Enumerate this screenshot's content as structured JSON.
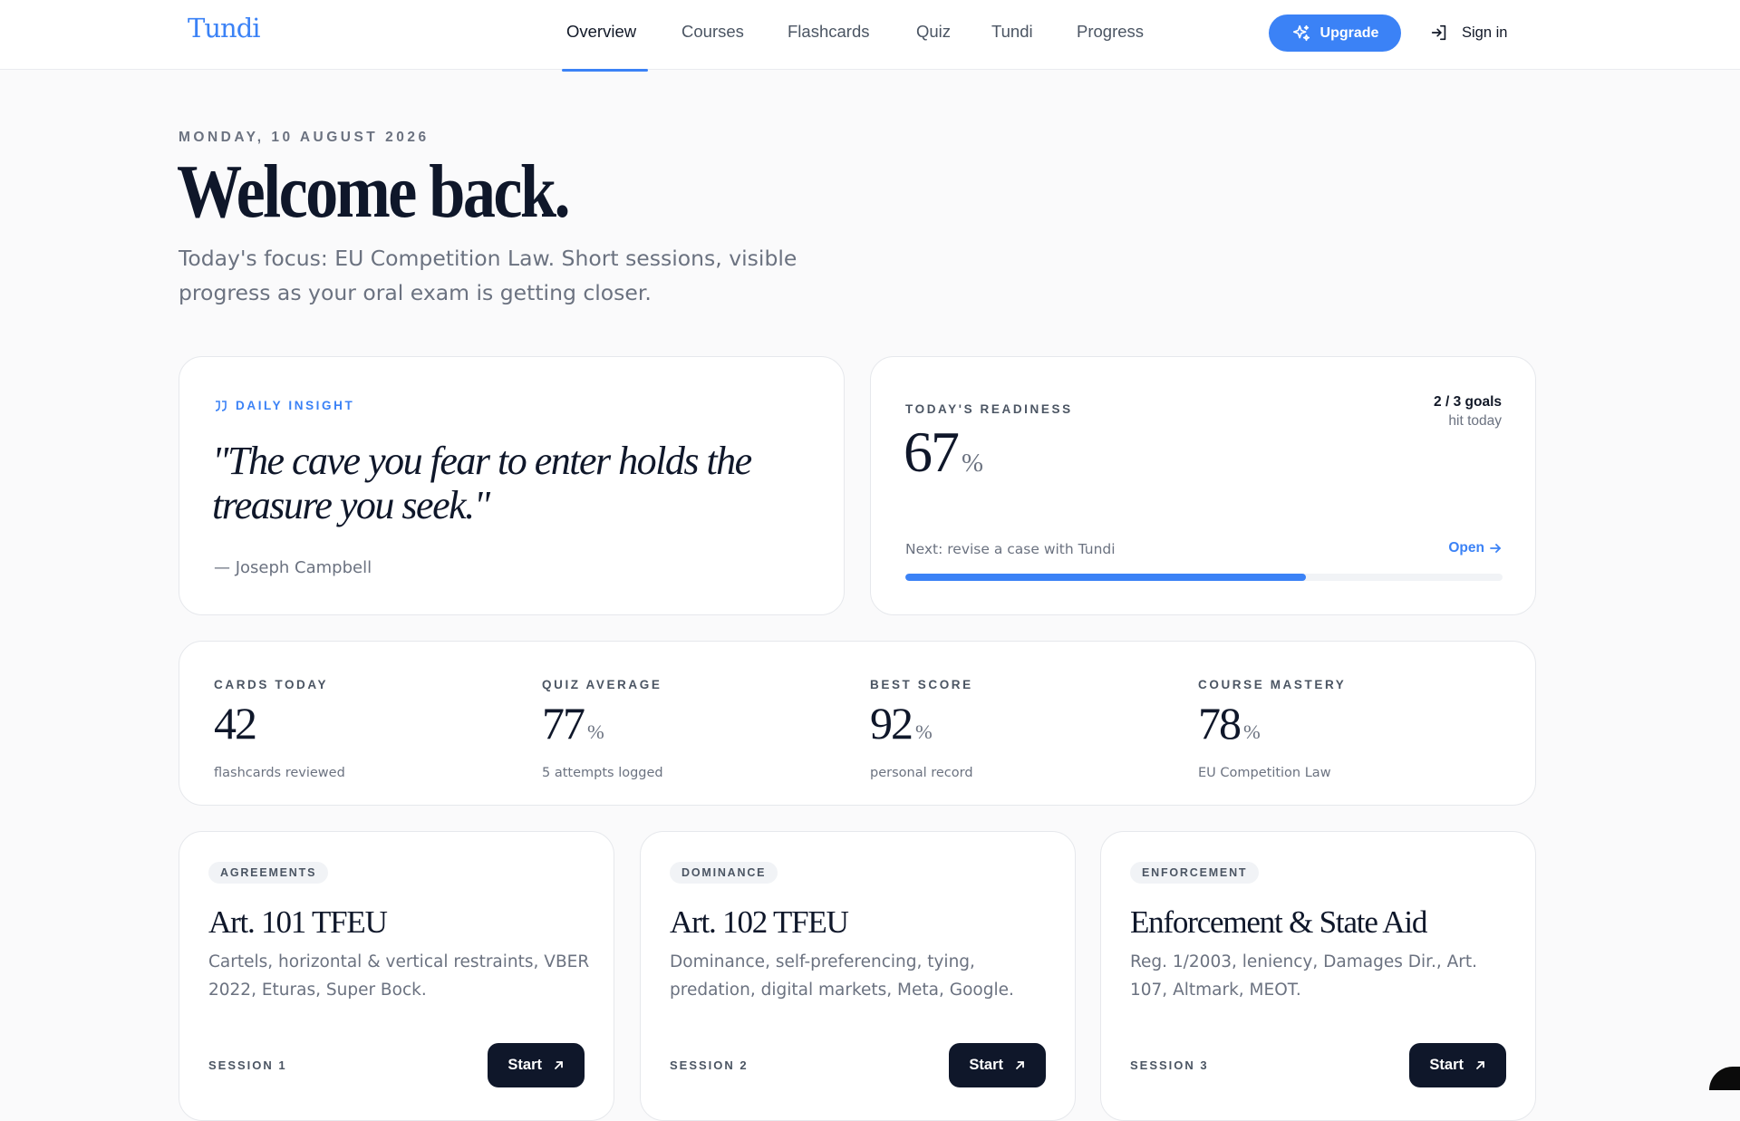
{
  "brand": {
    "logo": "Tundi",
    "accent": "#3b82f6",
    "dark": "#0f172a"
  },
  "nav": {
    "items": [
      "Overview",
      "Courses",
      "Flashcards",
      "Quiz",
      "Tundi",
      "Progress"
    ],
    "active": "Overview",
    "upgrade_label": "Upgrade",
    "signin_label": "Sign in"
  },
  "hero": {
    "date": "MONDAY, 10 AUGUST 2026",
    "title": "Welcome back.",
    "subtitle": "Today's focus: EU Competition Law. Short sessions, visible progress as your oral exam is getting closer."
  },
  "insight": {
    "label": "DAILY INSIGHT",
    "quote": "\"The cave you fear to enter holds the treasure you seek.\"",
    "author": "— Joseph Campbell"
  },
  "readiness": {
    "label": "TODAY'S READINESS",
    "value": "67",
    "unit": "%",
    "goals_line1": "2 / 3 goals",
    "goals_line2": "hit today",
    "next": "Next: revise a case with Tundi",
    "open_label": "Open",
    "progress": 0.67
  },
  "stats": [
    {
      "label": "CARDS TODAY",
      "value": "42",
      "unit": "",
      "note": "flashcards reviewed"
    },
    {
      "label": "QUIZ AVERAGE",
      "value": "77",
      "unit": "%",
      "note": "5 attempts logged"
    },
    {
      "label": "BEST SCORE",
      "value": "92",
      "unit": "%",
      "note": "personal record"
    },
    {
      "label": "COURSE MASTERY",
      "value": "78",
      "unit": "%",
      "note": "EU Competition Law"
    }
  ],
  "courses": [
    {
      "tag": "AGREEMENTS",
      "title": "Art. 101 TFEU",
      "desc": "Cartels, horizontal & vertical restraints, VBER 2022, Eturas, Super Bock.",
      "session": "SESSION 1",
      "cta": "Start"
    },
    {
      "tag": "DOMINANCE",
      "title": "Art. 102 TFEU",
      "desc": "Dominance, self-preferencing, tying, predation, digital markets, Meta, Google.",
      "session": "SESSION 2",
      "cta": "Start"
    },
    {
      "tag": "ENFORCEMENT",
      "title": "Enforcement & State Aid",
      "desc": "Reg. 1/2003, leniency, Damages Dir., Art. 107, Altmark, MEOT.",
      "session": "SESSION 3",
      "cta": "Start"
    }
  ],
  "icons": {
    "upgrade": "sparkles-icon",
    "signin": "login-arrow-icon",
    "insight": "quote-icon",
    "open": "arrow-right-icon",
    "start": "arrow-up-right-icon"
  }
}
